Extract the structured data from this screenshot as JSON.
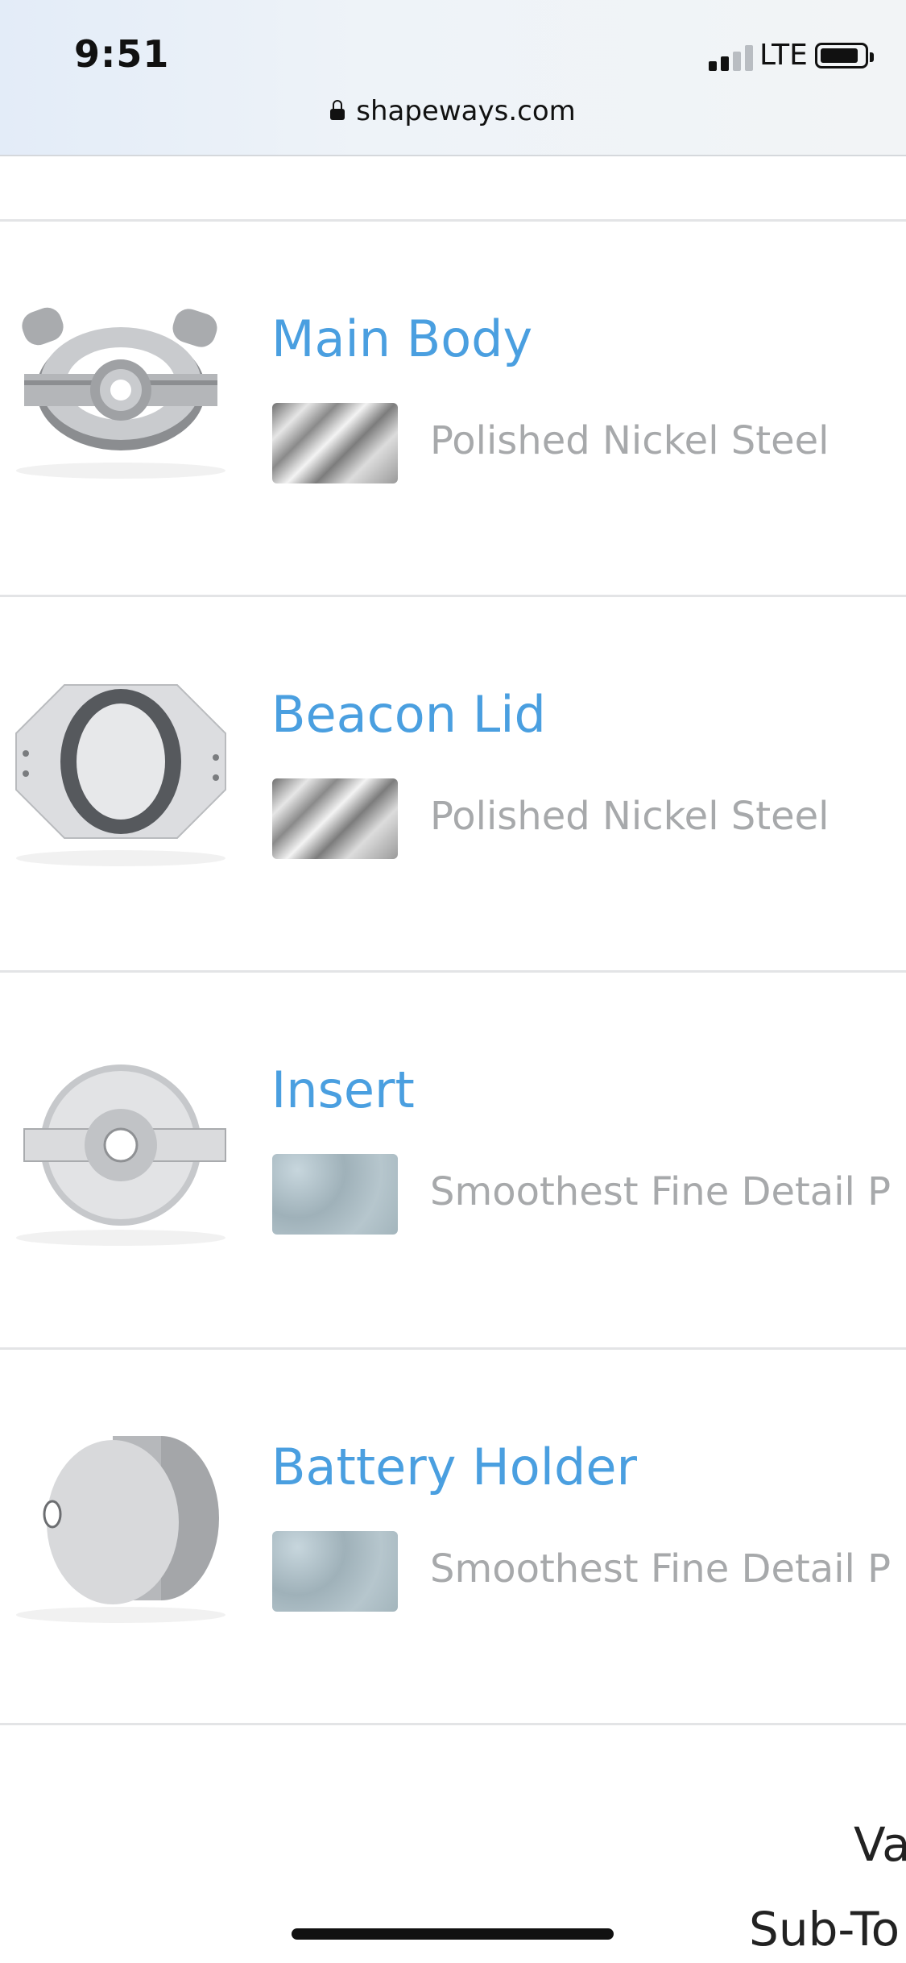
{
  "status_bar": {
    "time": "9:51",
    "carrier": "LTE"
  },
  "browser": {
    "url": "shapeways.com"
  },
  "items": [
    {
      "name": "Main Body",
      "material": "Polished Nickel Steel",
      "swatch": "polished-nickel-steel-swatch"
    },
    {
      "name": "Beacon Lid",
      "material": "Polished Nickel Steel",
      "swatch": "polished-nickel-steel-swatch"
    },
    {
      "name": "Insert",
      "material": "Smoothest Fine Detail P",
      "swatch": "smoothest-fine-detail-plastic-swatch"
    },
    {
      "name": "Battery Holder",
      "material": "Smoothest Fine Detail P",
      "swatch": "smoothest-fine-detail-plastic-swatch"
    }
  ],
  "summary": {
    "line1": "Va",
    "line2": "Sub-To"
  }
}
